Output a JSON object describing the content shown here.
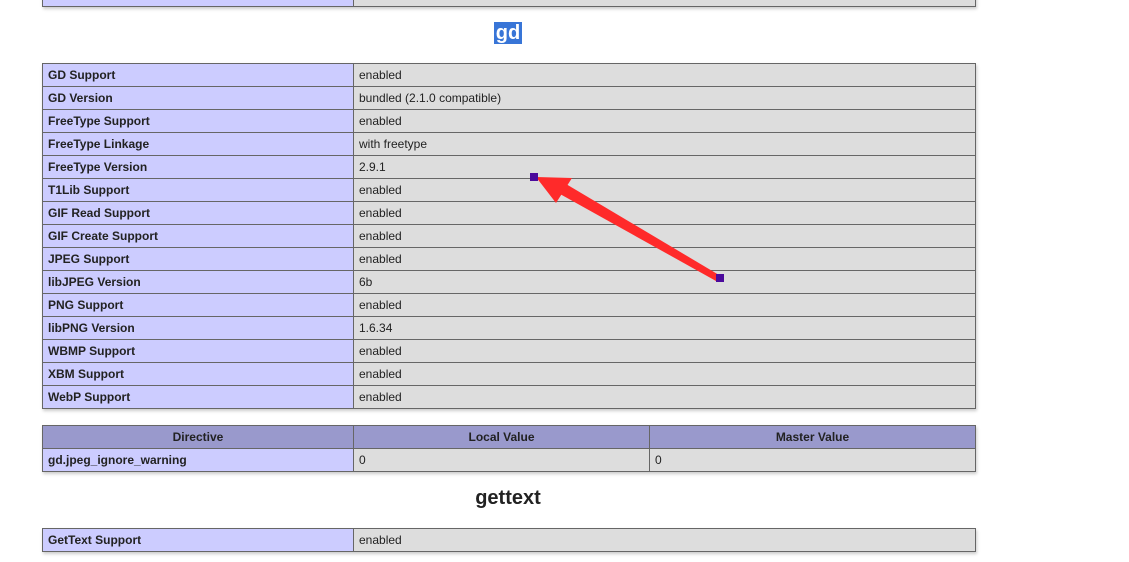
{
  "gd_section": {
    "title": "gd",
    "rows": [
      {
        "name": "GD Support",
        "value": "enabled"
      },
      {
        "name": "GD Version",
        "value": "bundled (2.1.0 compatible)"
      },
      {
        "name": "FreeType Support",
        "value": "enabled"
      },
      {
        "name": "FreeType Linkage",
        "value": "with freetype"
      },
      {
        "name": "FreeType Version",
        "value": "2.9.1"
      },
      {
        "name": "T1Lib Support",
        "value": "enabled"
      },
      {
        "name": "GIF Read Support",
        "value": "enabled"
      },
      {
        "name": "GIF Create Support",
        "value": "enabled"
      },
      {
        "name": "JPEG Support",
        "value": "enabled"
      },
      {
        "name": "libJPEG Version",
        "value": "6b"
      },
      {
        "name": "PNG Support",
        "value": "enabled"
      },
      {
        "name": "libPNG Version",
        "value": "1.6.34"
      },
      {
        "name": "WBMP Support",
        "value": "enabled"
      },
      {
        "name": "XBM Support",
        "value": "enabled"
      },
      {
        "name": "WebP Support",
        "value": "enabled"
      }
    ],
    "directives": {
      "headers": [
        "Directive",
        "Local Value",
        "Master Value"
      ],
      "rows": [
        {
          "directive": "gd.jpeg_ignore_warning",
          "local": "0",
          "master": "0"
        }
      ]
    }
  },
  "gettext_section": {
    "title": "gettext",
    "rows": [
      {
        "name": "GetText Support",
        "value": "enabled"
      }
    ]
  },
  "colors": {
    "key_cell": "#ccccff",
    "value_cell": "#dddddd",
    "header_cell": "#9999cc",
    "annotation_arrow": "#ff2a2a",
    "annotation_handle": "#4b0a9c",
    "selection_highlight": "#3875d7"
  }
}
